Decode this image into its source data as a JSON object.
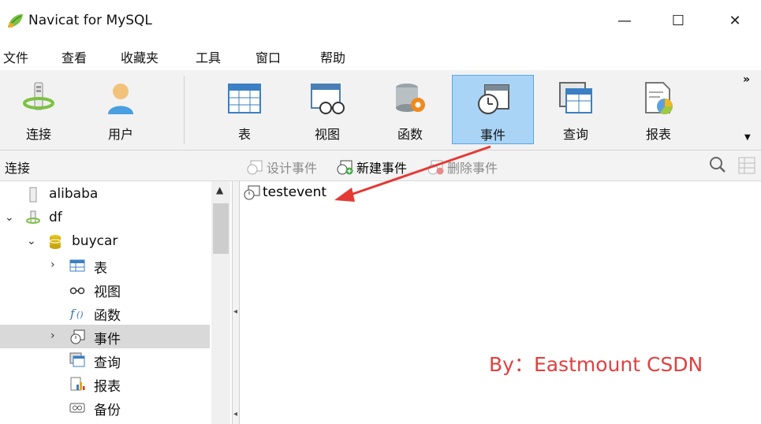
{
  "window": {
    "title": "Navicat for MySQL",
    "minimize": "—",
    "maximize": "☐",
    "close": "✕"
  },
  "menu": [
    "文件",
    "查看",
    "收藏夹",
    "工具",
    "窗口",
    "帮助"
  ],
  "toolbar": {
    "items": [
      {
        "label": "连接",
        "icon": "connection-icon"
      },
      {
        "label": "用户",
        "icon": "user-icon"
      },
      {
        "label": "表",
        "icon": "table-icon"
      },
      {
        "label": "视图",
        "icon": "view-icon"
      },
      {
        "label": "函数",
        "icon": "function-icon"
      },
      {
        "label": "事件",
        "icon": "event-icon",
        "active": true
      },
      {
        "label": "查询",
        "icon": "query-icon"
      },
      {
        "label": "报表",
        "icon": "report-icon"
      }
    ],
    "more": "»",
    "more_down": "▼"
  },
  "subbar": {
    "connection_label": "连接",
    "design_event": "设计事件",
    "new_event": "新建事件",
    "delete_event": "删除事件"
  },
  "tree": [
    {
      "label": "alibaba",
      "arrow": "",
      "icon": "server-icon"
    },
    {
      "label": "df",
      "arrow": "⌄",
      "icon": "connection-icon"
    },
    {
      "label": "buycar",
      "arrow": "⌄",
      "icon": "database-icon"
    },
    {
      "label": "表",
      "arrow": "›",
      "icon": "table-icon"
    },
    {
      "label": "视图",
      "arrow": "",
      "icon": "view-icon"
    },
    {
      "label": "函数",
      "arrow": "",
      "icon": "function-icon"
    },
    {
      "label": "事件",
      "arrow": "›",
      "icon": "event-icon",
      "selected": true
    },
    {
      "label": "查询",
      "arrow": "",
      "icon": "query-icon"
    },
    {
      "label": "报表",
      "arrow": "",
      "icon": "report-icon"
    },
    {
      "label": "备份",
      "arrow": "",
      "icon": "backup-icon"
    }
  ],
  "objects": [
    {
      "label": "testevent"
    }
  ],
  "watermark": "By：Eastmount CSDN",
  "colors": {
    "active_bg": "#a9d4f6",
    "annotation_red": "#e53935"
  }
}
